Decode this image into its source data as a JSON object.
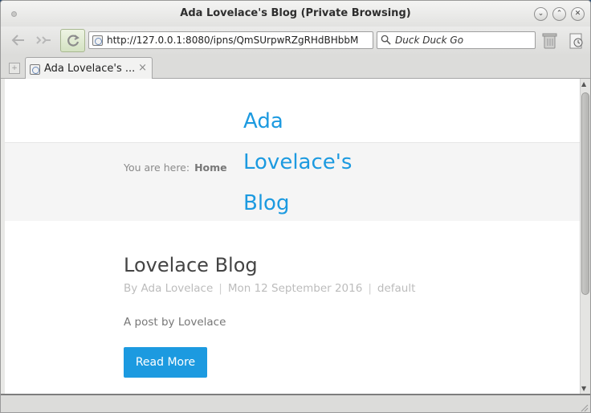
{
  "window": {
    "title": "Ada Lovelace's Blog (Private Browsing)",
    "controls": {
      "minimize": "⌄",
      "maximize": "⌃",
      "close": "✕"
    }
  },
  "toolbar": {
    "back_icon": "back-arrow-icon",
    "forward_icon": "forward-arrow-icon",
    "reload_icon": "reload-icon",
    "url": "http://127.0.0.1:8080/ipns/QmSUrpwRZgRHdBHbbM",
    "search_placeholder": "Duck Duck Go"
  },
  "tabs": [
    {
      "label": "Ada Lovelace's ...",
      "close": "×"
    }
  ],
  "page": {
    "site_title_lines": [
      "Ada",
      "Lovelace's",
      "Blog"
    ],
    "breadcrumb": {
      "prefix": "You are here:",
      "current": "Home"
    },
    "post": {
      "title": "Lovelace Blog",
      "author": "By Ada Lovelace",
      "date": "Mon 12 September 2016",
      "category": "default",
      "summary": "A post by Lovelace",
      "read_more": "Read More"
    }
  },
  "colors": {
    "accent": "#1c9ae0",
    "title_bar": "#e6e6e4"
  }
}
